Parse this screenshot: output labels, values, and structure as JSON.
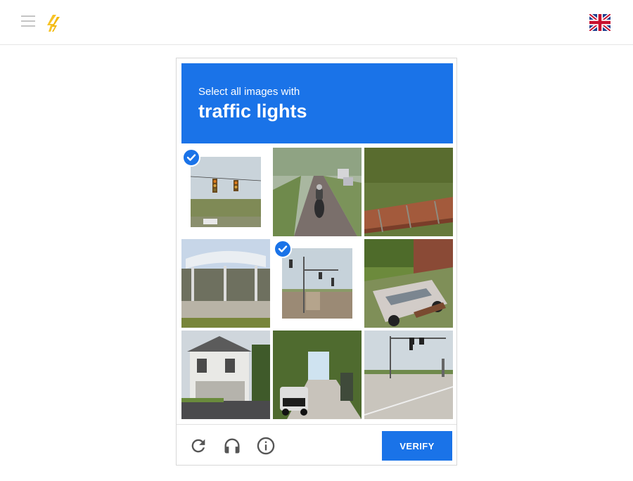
{
  "header": {
    "icons": [
      "menu-icon",
      "lightning-logo-icon",
      "uk-flag-icon"
    ]
  },
  "captcha": {
    "instruction_line1": "Select all images with",
    "instruction_target": "traffic lights",
    "accent_color": "#1a73e8",
    "tiles": [
      {
        "content": "traffic lights on wire",
        "selected": true
      },
      {
        "content": "motorcycle on road",
        "selected": false
      },
      {
        "content": "red metal structure and trees",
        "selected": false
      },
      {
        "content": "gas station canopy",
        "selected": false
      },
      {
        "content": "traffic light at crosswalk",
        "selected": true
      },
      {
        "content": "old station wagon",
        "selected": false
      },
      {
        "content": "house with porch",
        "selected": false
      },
      {
        "content": "street with car under trees",
        "selected": false
      },
      {
        "content": "traffic lights at intersection",
        "selected": false
      }
    ],
    "footer": {
      "icons": [
        "reload-icon",
        "headphones-icon",
        "info-icon"
      ],
      "verify_label": "VERIFY"
    }
  }
}
